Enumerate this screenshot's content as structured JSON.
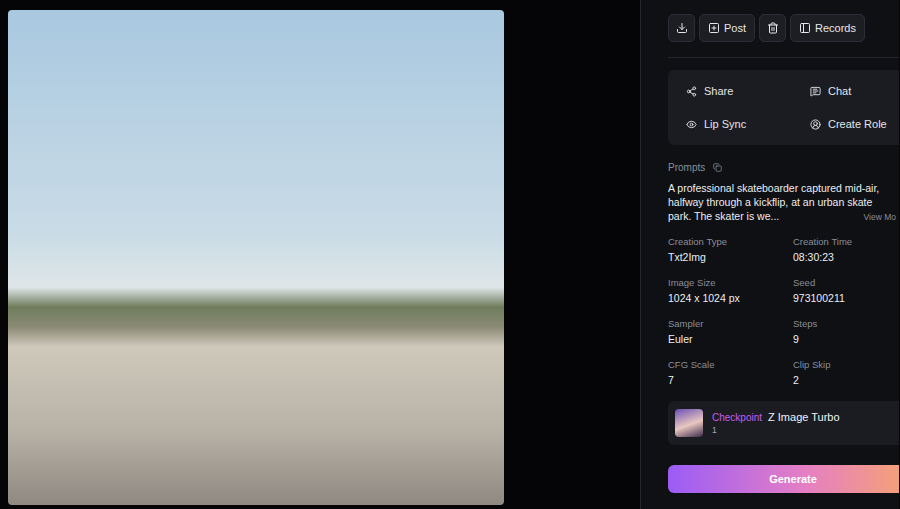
{
  "toolbar": [
    {
      "kind": "icon",
      "label": ""
    },
    {
      "kind": "labeled",
      "label": "Post"
    },
    {
      "kind": "icon",
      "label": ""
    },
    {
      "kind": "labeled",
      "label": "Records"
    }
  ],
  "actions": [
    "Share",
    "Chat",
    "Lip Sync",
    "Create Role"
  ],
  "prompts": {
    "label": "Prompts",
    "lines": [
      "A professional skateboarder captured mid-air,",
      "halfway through a kickflip, at an urban skate",
      "park. The skater is we..."
    ],
    "more": "View Mo"
  },
  "details": [
    {
      "label": "Creation Type",
      "value": "Txt2Img"
    },
    {
      "label": "Creation Time",
      "value": "08:30:23"
    },
    {
      "label": "Image Size",
      "value": "1024 x 1024 px"
    },
    {
      "label": "Seed",
      "value": "973100211"
    },
    {
      "label": "Sampler",
      "value": "Euler"
    },
    {
      "label": "Steps",
      "value": "9"
    },
    {
      "label": "CFG Scale",
      "value": "7"
    },
    {
      "label": "Clip Skip",
      "value": "2"
    }
  ],
  "checkpoint": {
    "tag": "Checkpoint",
    "name": "Z Image Turbo",
    "count": "1"
  },
  "generate": {
    "label": "Generate"
  }
}
